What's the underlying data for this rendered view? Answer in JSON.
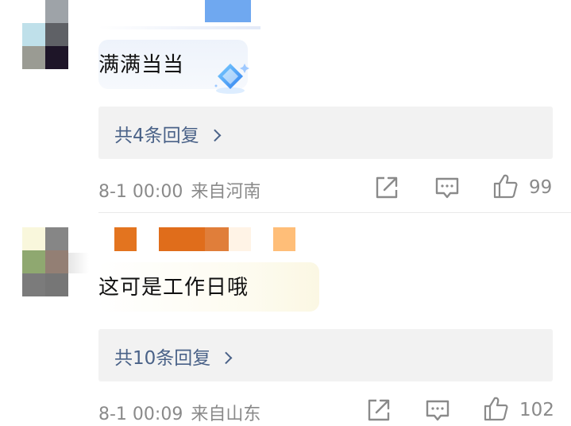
{
  "comments": [
    {
      "text": "满满当当",
      "replies_label": "共4条回复",
      "timestamp": "8-1 00:00",
      "location": "来自河南",
      "likes": "99",
      "avatar_colors": [
        "#ffffff",
        "#9ea3a8",
        "#bfe0ea",
        "#5f6166",
        "#9a9b93",
        "#1e1528"
      ],
      "name_colors": [
        "#6fa8f0"
      ],
      "sticker": "diamond-sticker"
    },
    {
      "text": "这可是工作日哦",
      "replies_label": "共10条回复",
      "timestamp": "8-1 00:09",
      "location": "来自山东",
      "likes": "102",
      "avatar_colors": [
        "#f9f7dc",
        "#868686",
        "#8fa870",
        "#937f74",
        "#7b7b7b",
        "#767676"
      ],
      "name_colors": [
        "#e3741f",
        "#e06d1b",
        "#fff3e6",
        "#ffbe78"
      ]
    }
  ],
  "icons": {
    "share": "share-icon",
    "comment": "comment-icon",
    "like": "thumbs-up-icon"
  },
  "colors": {
    "reply_link": "#4a6288",
    "meta": "#8a8a8a",
    "reply_box": "#f2f2f2"
  }
}
